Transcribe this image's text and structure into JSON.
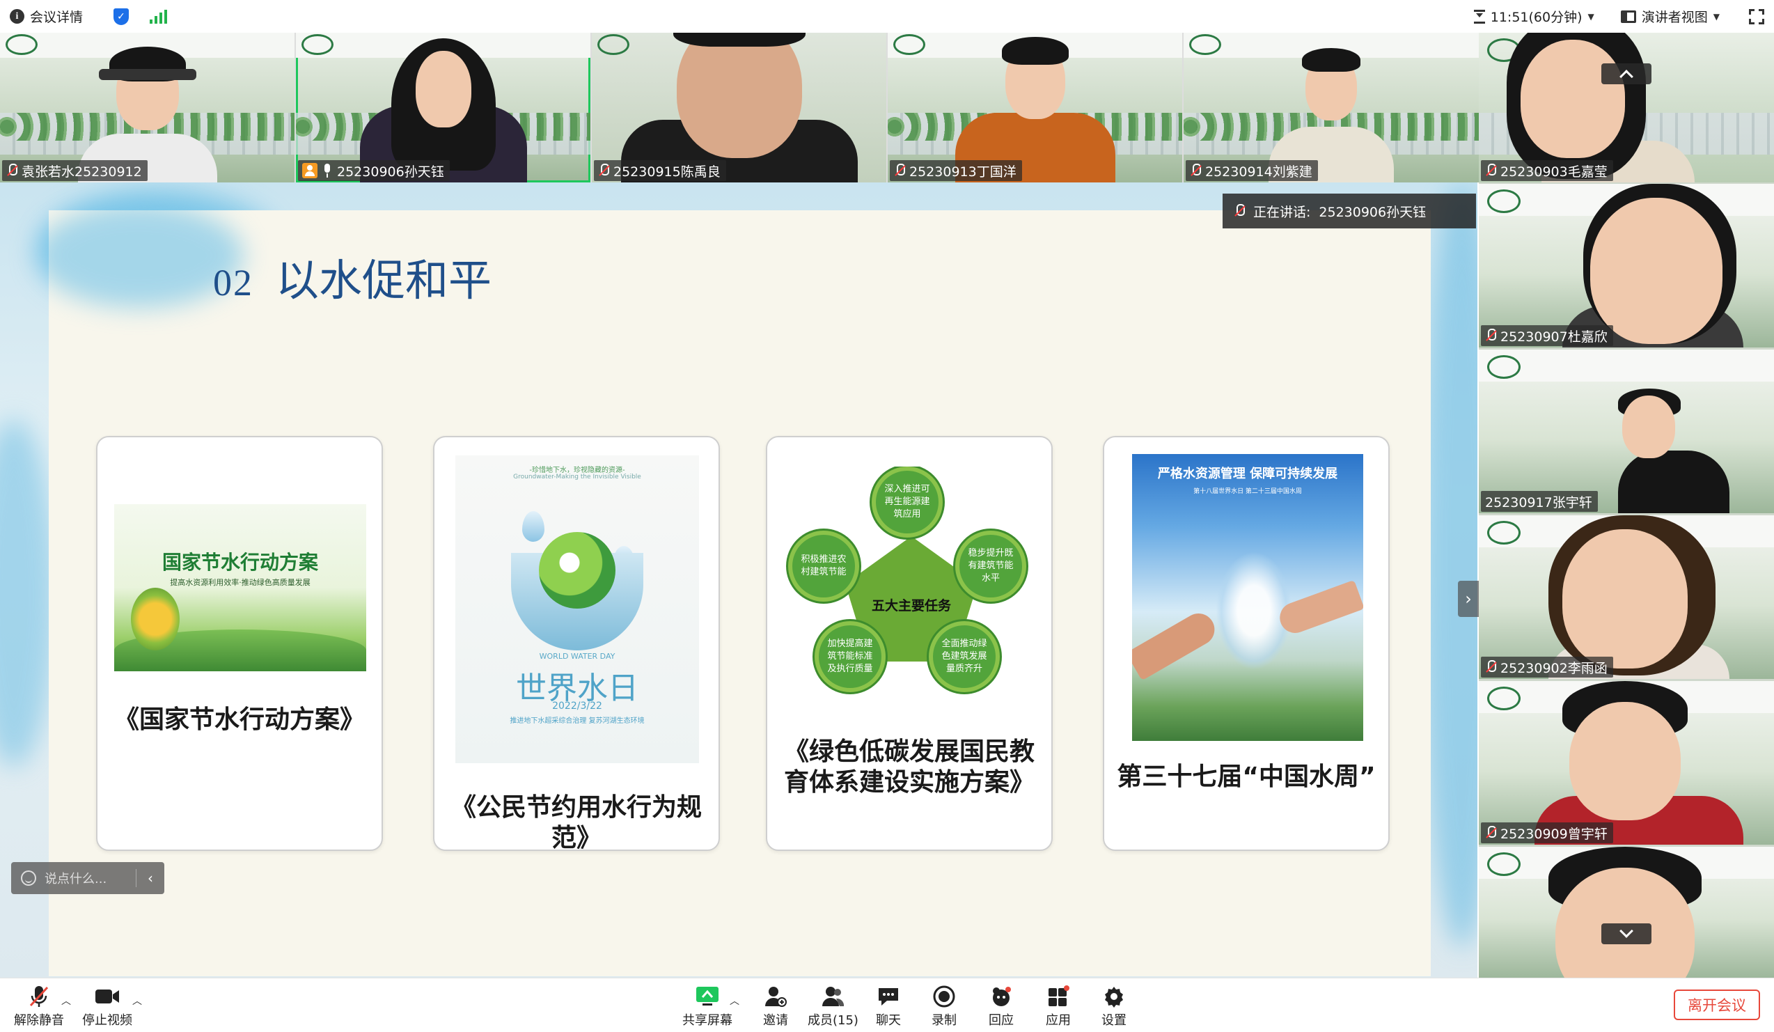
{
  "topbar": {
    "meeting_info": "会议详情",
    "timer": "11:51(60分钟)",
    "view": "演讲者视图",
    "colors": {
      "shield": "#1c6fe8",
      "signal": "#22b34b"
    }
  },
  "strip": [
    {
      "name": "袁张若水25230912",
      "mic": "off"
    },
    {
      "name": "25230906孙天钰",
      "mic": "on",
      "host": true,
      "active": true
    },
    {
      "name": "25230915陈禹良",
      "mic": "off"
    },
    {
      "name": "25230913丁国洋",
      "mic": "off"
    },
    {
      "name": "25230914刘紫建",
      "mic": "off"
    }
  ],
  "right_column": [
    {
      "name": "25230903毛嘉莹",
      "mic": "off"
    },
    {
      "name": "25230907杜嘉欣",
      "mic": "off"
    },
    {
      "name": "25230917张宇轩",
      "mic": "none"
    },
    {
      "name": "25230902李雨函",
      "mic": "off"
    },
    {
      "name": "25230909曾宇轩",
      "mic": "off"
    },
    {
      "name": "",
      "mic": "none"
    }
  ],
  "speaking": {
    "label": "正在讲话:",
    "name": "25230906孙天钰"
  },
  "slide": {
    "number": "02",
    "title": "以水促和平",
    "cards": [
      {
        "caption": "《国家节水行动方案》",
        "poster_title": "国家节水行动方案",
        "poster_sub": "提高水资源利用效率·推动绿色高质量发展"
      },
      {
        "caption": "《公民节约用水行为规范》",
        "poster_en": "WORLD WATER DAY",
        "poster_cn": "世界水日",
        "poster_date": "2022/3/22",
        "poster_head": "-珍惜地下水，珍视隐藏的资源-",
        "poster_head2": "Groundwater-Making the Invisible Visible",
        "poster_foot": "推进地下水超采综合治理 复苏河湖生态环境"
      },
      {
        "caption": "《绿色低碳发展国民教育体系建设实施方案》",
        "center": "五大主要任务",
        "nodes": [
          "深入推进可再生能源建筑应用",
          "稳步提升既有建筑节能水平",
          "全面推动绿色建筑发展量质齐升",
          "加快提高建筑节能标准及执行质量",
          "积极推进农村建筑节能"
        ]
      },
      {
        "caption": "第三十七届“中国水周”",
        "poster_title": "严格水资源管理 保障可持续发展",
        "poster_sub": "第十八届世界水日 第二十三届中国水周"
      }
    ]
  },
  "chat": {
    "placeholder": "说点什么..."
  },
  "toolbar": {
    "mute": "解除静音",
    "video": "停止视频",
    "share": "共享屏幕",
    "invite": "邀请",
    "members": "成员(15)",
    "chat": "聊天",
    "record": "录制",
    "react": "回应",
    "apps": "应用",
    "settings": "设置",
    "leave": "离开会议",
    "colors": {
      "share": "#1ec75c",
      "leave": "#e7483b"
    }
  }
}
